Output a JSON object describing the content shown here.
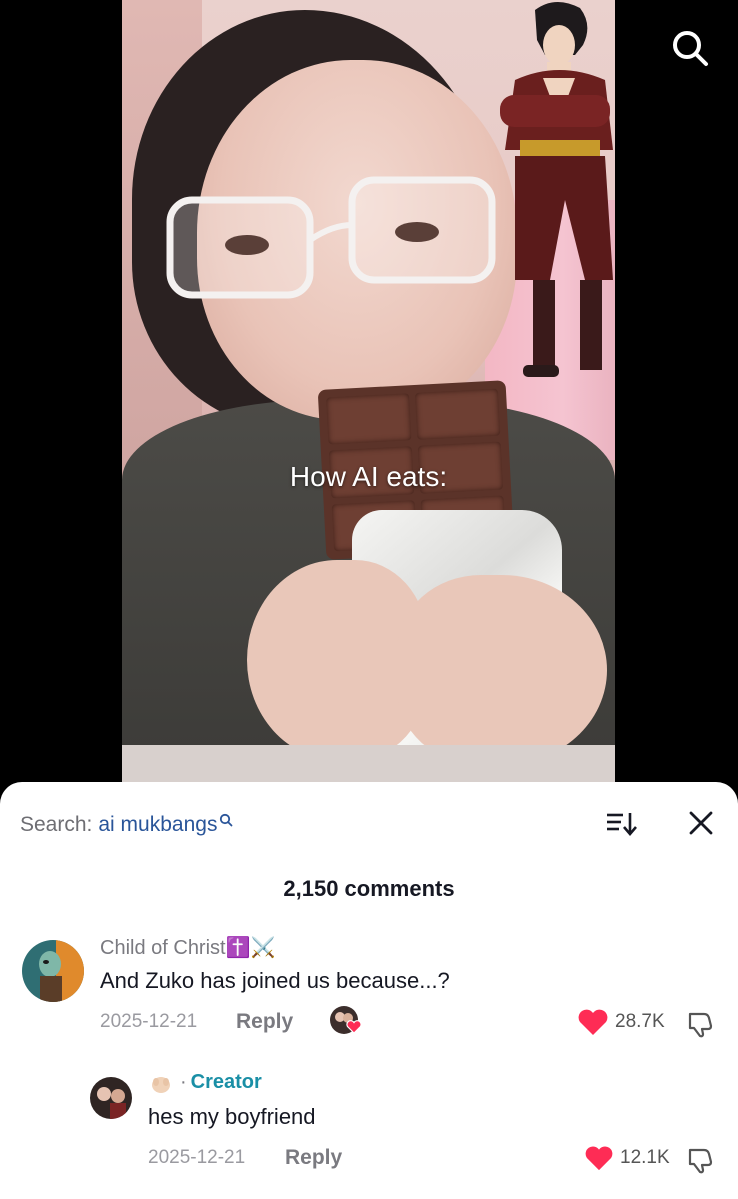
{
  "video": {
    "caption": "How AI eats:"
  },
  "comments_sheet": {
    "search_prefix": "Search:",
    "search_term": "ai mukbangs",
    "comment_count": "2,150 comments"
  },
  "comments": [
    {
      "username": "Child of Christ",
      "username_emojis": "✝️⚔️",
      "text": "And Zuko has joined us because...?",
      "date": "2025-12-21",
      "reply_label": "Reply",
      "likes": "28.7K"
    }
  ],
  "replies": [
    {
      "creator_label": "Creator",
      "text": "hes my boyfriend",
      "date": "2025-12-21",
      "reply_label": "Reply",
      "likes": "12.1K"
    }
  ],
  "colors": {
    "like_red": "#fe2c55",
    "creator_teal": "#1a8fa6",
    "search_term_blue": "#2a5599"
  }
}
